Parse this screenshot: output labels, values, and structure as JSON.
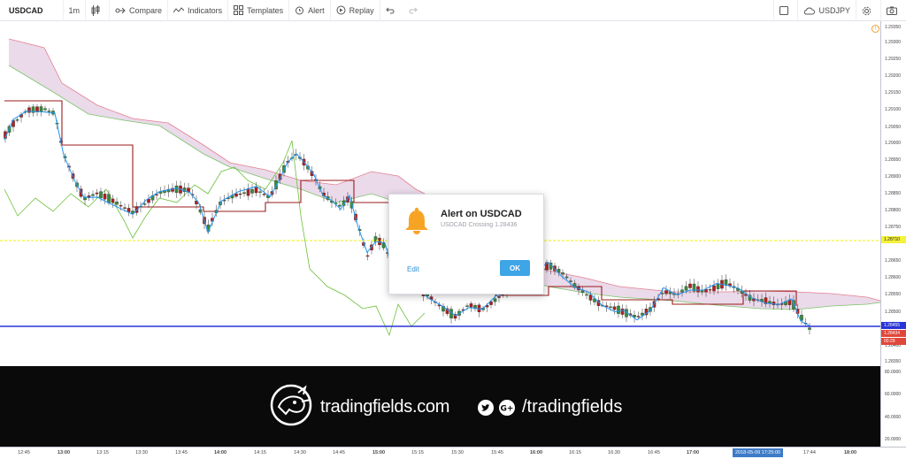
{
  "toolbar": {
    "symbol": "USDCAD",
    "interval": "1m",
    "compare": "Compare",
    "indicators": "Indicators",
    "templates": "Templates",
    "alert": "Alert",
    "replay": "Replay",
    "right_symbol": "USDJPY"
  },
  "dialog": {
    "title": "Alert on USDCAD",
    "subtitle": "USDCAD Crossing 1.28436",
    "edit": "Edit",
    "ok": "OK"
  },
  "banner": {
    "brand": "tradingfields.com",
    "handle": "/tradingfields"
  },
  "price_axis": {
    "labels": [
      "1.29350",
      "1.29300",
      "1.29250",
      "1.29200",
      "1.29150",
      "1.29100",
      "1.29050",
      "1.29000",
      "1.28950",
      "1.28900",
      "1.28850",
      "1.28800",
      "1.28750",
      "1.28650",
      "1.28600",
      "1.28550",
      "1.28500",
      "1.28400",
      "1.28350"
    ],
    "tags": [
      {
        "text": "1.28710",
        "color": "#f5f23a",
        "fg": "#222"
      },
      {
        "text": "1.28455",
        "color": "#2933d8",
        "fg": "#fff"
      },
      {
        "text": "1.28434",
        "color": "#e0473b",
        "fg": "#fff"
      },
      {
        "text": "00:29",
        "color": "#e0473b",
        "fg": "#fff"
      }
    ],
    "osc_labels": [
      "80.0000",
      "60.0000",
      "40.0000",
      "20.0000"
    ]
  },
  "time_axis": {
    "labels": [
      {
        "text": "12:45",
        "bold": false
      },
      {
        "text": "13:00",
        "bold": true
      },
      {
        "text": "13:15",
        "bold": false
      },
      {
        "text": "13:30",
        "bold": false
      },
      {
        "text": "13:45",
        "bold": false
      },
      {
        "text": "14:00",
        "bold": true
      },
      {
        "text": "14:15",
        "bold": false
      },
      {
        "text": "14:30",
        "bold": false
      },
      {
        "text": "14:45",
        "bold": false
      },
      {
        "text": "15:00",
        "bold": true
      },
      {
        "text": "15:15",
        "bold": false
      },
      {
        "text": "15:30",
        "bold": false
      },
      {
        "text": "15:45",
        "bold": false
      },
      {
        "text": "16:00",
        "bold": true
      },
      {
        "text": "16:15",
        "bold": false
      },
      {
        "text": "16:30",
        "bold": false
      },
      {
        "text": "16:45",
        "bold": false
      },
      {
        "text": "17:00",
        "bold": true
      },
      {
        "text": "17:44",
        "bold": false
      },
      {
        "text": "18:00",
        "bold": true
      }
    ],
    "cursor_label": "2018-05-09 17:25:00"
  },
  "colors": {
    "cloud": "#d8bcd9",
    "tenkan": "#2196f3",
    "kijun": "#9b1b1b",
    "chikou": "#6cbf3b",
    "alert_line": "#f5f23a",
    "price_line": "#2933d8",
    "candle_up": "#3a8a3a",
    "candle_down": "#b02020"
  }
}
